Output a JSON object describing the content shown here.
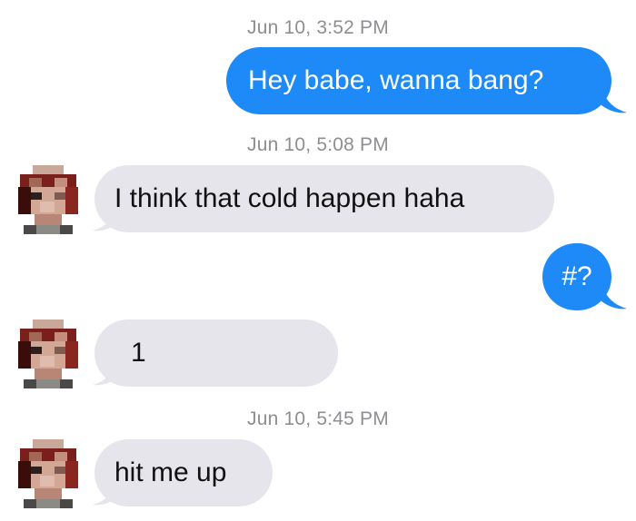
{
  "conversation": {
    "messages": [
      {
        "type": "timestamp",
        "text": "Jun 10, 3:52 PM"
      },
      {
        "type": "sent",
        "text": "Hey babe, wanna bang?"
      },
      {
        "type": "timestamp",
        "text": "Jun 10, 5:08 PM"
      },
      {
        "type": "received",
        "text": "I think that cold happen haha"
      },
      {
        "type": "sent",
        "text": "#?"
      },
      {
        "type": "received",
        "text": "1"
      },
      {
        "type": "timestamp",
        "text": "Jun 10, 5:45 PM"
      },
      {
        "type": "received",
        "text": "hit me up"
      }
    ]
  },
  "colors": {
    "sent_bubble": "#1e8af7",
    "received_bubble": "#e6e5eb",
    "timestamp_text": "#8e8e93",
    "background": "#ffffff"
  },
  "icons": {
    "avatar": "pixelated-avatar-icon"
  }
}
